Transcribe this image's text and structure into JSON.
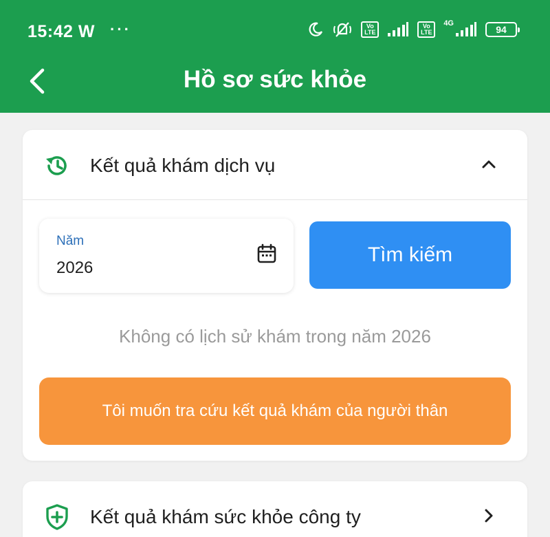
{
  "status_bar": {
    "time": "15:42 W",
    "dots": "···",
    "volte_1": "Vo LTE",
    "volte_2": "Vo LTE",
    "network": "4G",
    "battery": "94"
  },
  "header": {
    "title": "Hồ sơ sức khỏe",
    "background_color": "#1c9e4f"
  },
  "service_results": {
    "title": "Kết quả khám dịch vụ",
    "icon": "history-icon",
    "year_field": {
      "label": "Năm",
      "value": "2026"
    },
    "search_label": "Tìm kiếm",
    "empty_message": "Không có lịch sử khám trong năm 2026",
    "relative_lookup_label": "Tôi muốn tra cứu kết quả khám của người thân",
    "search_color": "#2f8ff3",
    "relative_color": "#f7953c"
  },
  "company_results": {
    "title": "Kết quả khám sức khỏe công ty",
    "icon": "shield-plus-icon"
  }
}
